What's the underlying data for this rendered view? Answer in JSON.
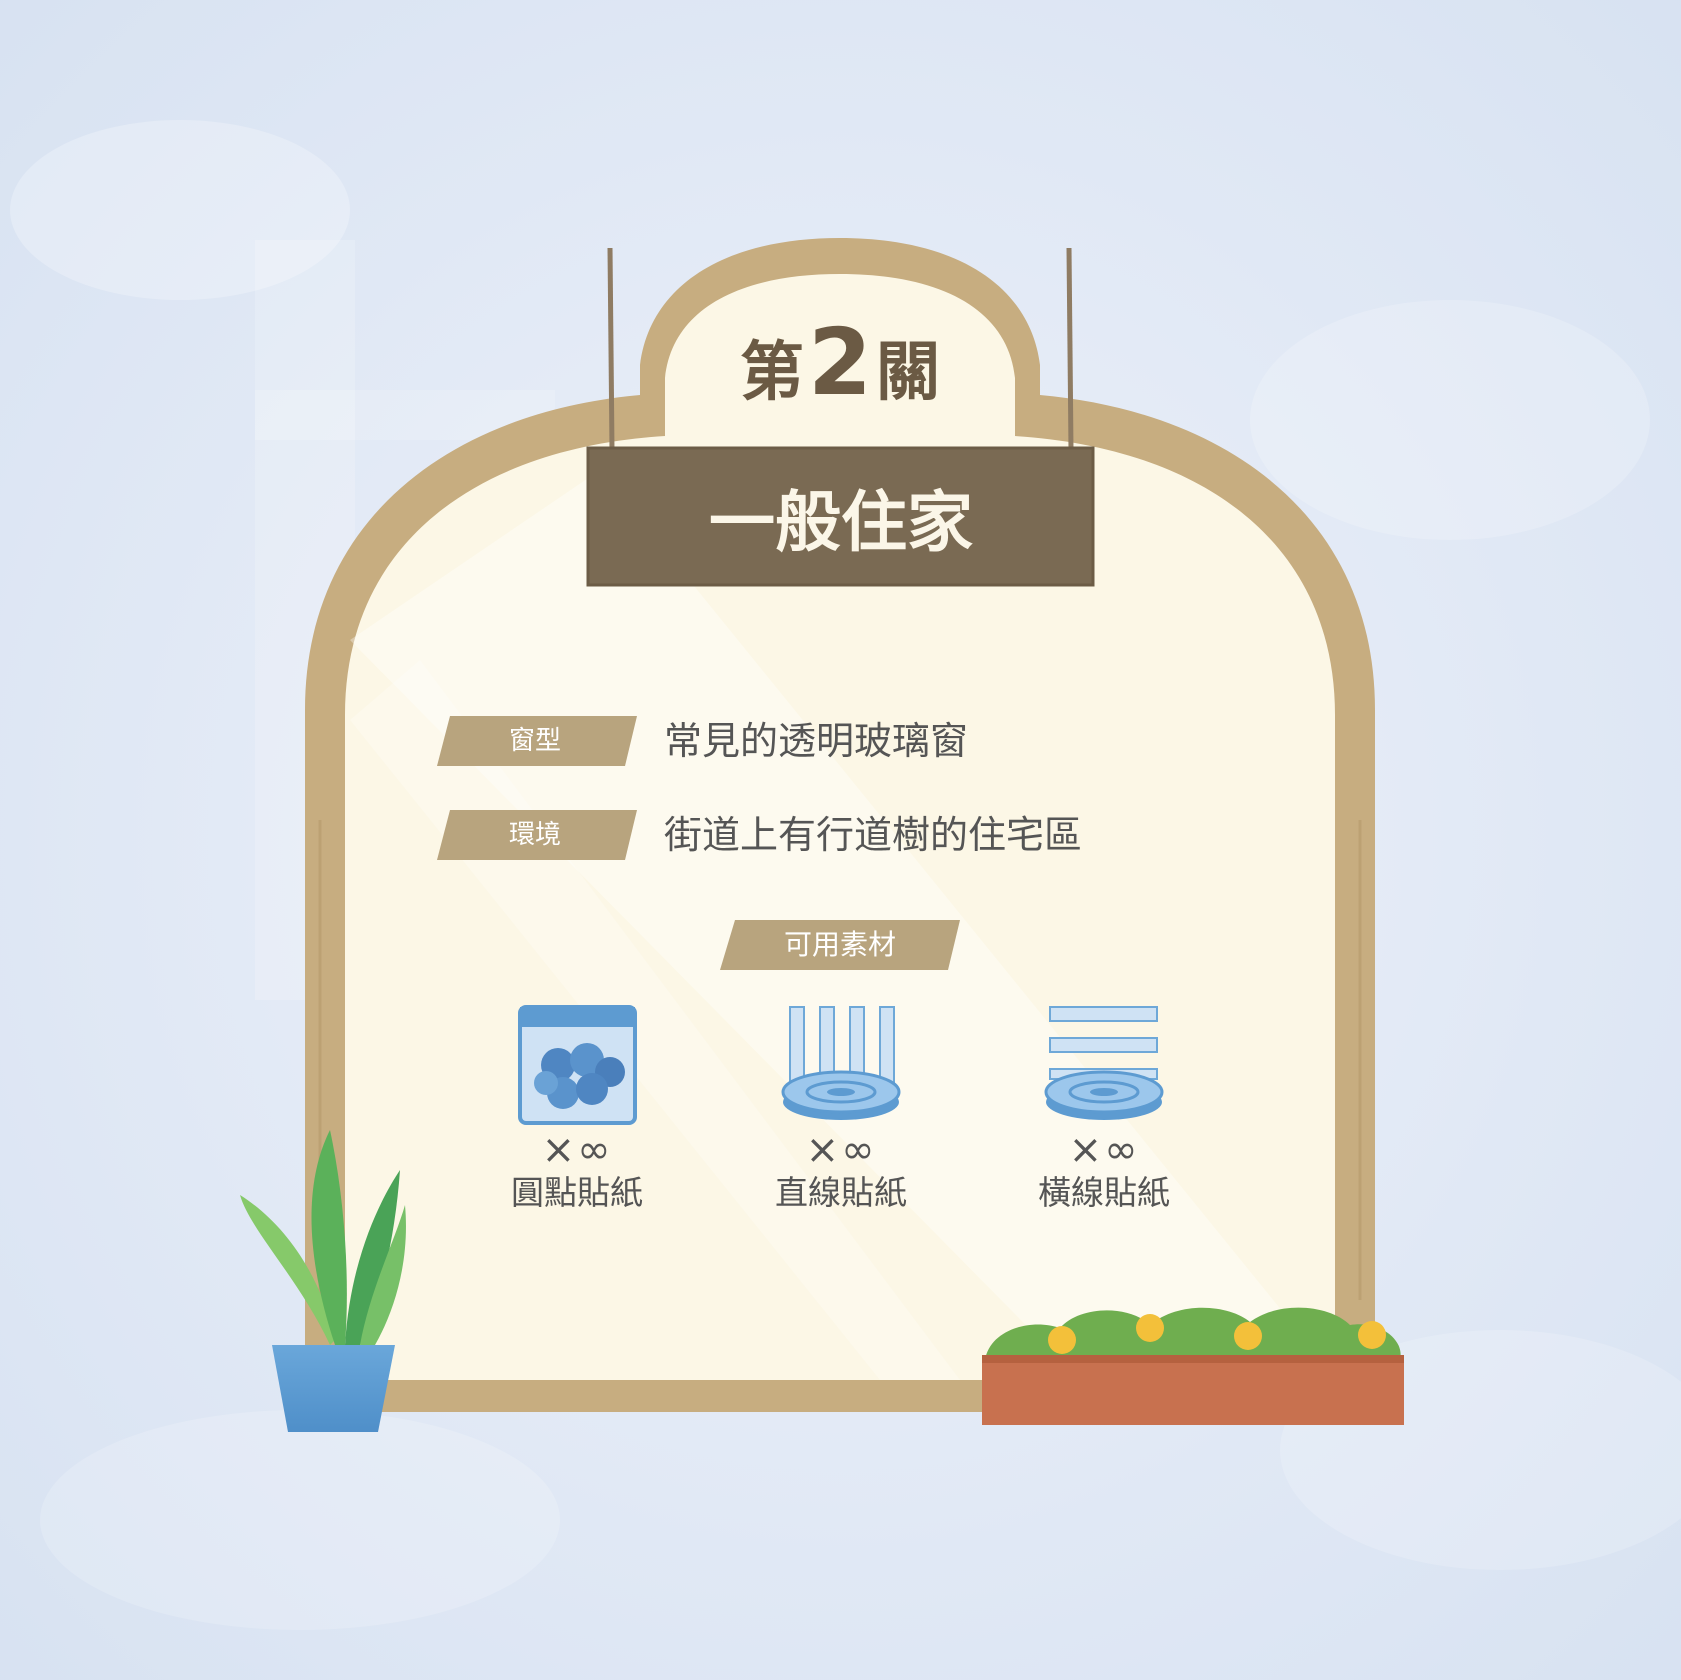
{
  "level": {
    "prefix": "第",
    "number": "2",
    "suffix": "關"
  },
  "sign": {
    "title": "一般住家"
  },
  "info": [
    {
      "label": "窗型",
      "value": "常見的透明玻璃窗"
    },
    {
      "label": "環境",
      "value": "街道上有行道樹的住宅區"
    }
  ],
  "materials": {
    "title": "可用素材",
    "items": [
      {
        "icon": "dot-stickers-bag-icon",
        "count": "×∞",
        "name": "圓點貼紙"
      },
      {
        "icon": "vertical-line-stickers-icon",
        "count": "×∞",
        "name": "直線貼紙"
      },
      {
        "icon": "horizontal-line-stickers-icon",
        "count": "×∞",
        "name": "橫線貼紙"
      }
    ]
  },
  "colors": {
    "background": "#dfe7f4",
    "frame_wood": "#c7ad80",
    "panel": "#fcf7e6",
    "sign": "#7a6a53",
    "tag": "#b8a47e",
    "text": "#555555",
    "sticker_blue": "#6ea8d8"
  }
}
